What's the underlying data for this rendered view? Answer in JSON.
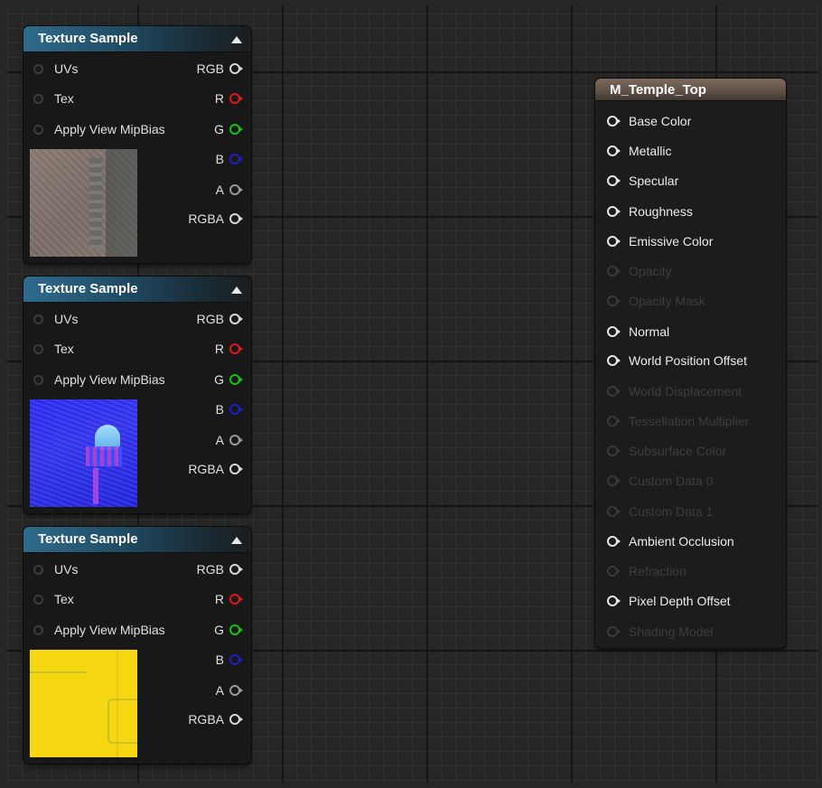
{
  "texture_nodes": [
    {
      "title": "Texture Sample",
      "inputs": [
        "UVs",
        "Tex",
        "Apply View MipBias"
      ],
      "outputs": [
        {
          "label": "RGB",
          "pin": "white-pin-icon"
        },
        {
          "label": "R",
          "pin": "red-pin-icon"
        },
        {
          "label": "G",
          "pin": "green-pin-icon"
        },
        {
          "label": "B",
          "pin": "blue-pin-icon"
        },
        {
          "label": "A",
          "pin": "gray-pin-icon"
        },
        {
          "label": "RGBA",
          "pin": "white-pin-icon"
        }
      ]
    },
    {
      "title": "Texture Sample",
      "inputs": [
        "UVs",
        "Tex",
        "Apply View MipBias"
      ],
      "outputs": [
        {
          "label": "RGB",
          "pin": "white-pin-icon"
        },
        {
          "label": "R",
          "pin": "red-pin-icon"
        },
        {
          "label": "G",
          "pin": "green-pin-icon"
        },
        {
          "label": "B",
          "pin": "blue-pin-icon"
        },
        {
          "label": "A",
          "pin": "gray-pin-icon"
        },
        {
          "label": "RGBA",
          "pin": "white-pin-icon"
        }
      ]
    },
    {
      "title": "Texture Sample",
      "inputs": [
        "UVs",
        "Tex",
        "Apply View MipBias"
      ],
      "outputs": [
        {
          "label": "RGB",
          "pin": "white-pin-icon"
        },
        {
          "label": "R",
          "pin": "red-pin-icon"
        },
        {
          "label": "G",
          "pin": "green-pin-icon"
        },
        {
          "label": "B",
          "pin": "blue-pin-icon"
        },
        {
          "label": "A",
          "pin": "gray-pin-icon"
        },
        {
          "label": "RGBA",
          "pin": "white-pin-icon"
        }
      ]
    }
  ],
  "material_node": {
    "title": "M_Temple_Top",
    "inputs": [
      {
        "label": "Base Color",
        "enabled": true
      },
      {
        "label": "Metallic",
        "enabled": true
      },
      {
        "label": "Specular",
        "enabled": true
      },
      {
        "label": "Roughness",
        "enabled": true
      },
      {
        "label": "Emissive Color",
        "enabled": true
      },
      {
        "label": "Opacity",
        "enabled": false
      },
      {
        "label": "Opacity Mask",
        "enabled": false
      },
      {
        "label": "Normal",
        "enabled": true
      },
      {
        "label": "World Position Offset",
        "enabled": true
      },
      {
        "label": "World Displacement",
        "enabled": false
      },
      {
        "label": "Tessellation Multiplier",
        "enabled": false
      },
      {
        "label": "Subsurface Color",
        "enabled": false
      },
      {
        "label": "Custom Data 0",
        "enabled": false
      },
      {
        "label": "Custom Data 1",
        "enabled": false
      },
      {
        "label": "Ambient Occlusion",
        "enabled": true
      },
      {
        "label": "Refraction",
        "enabled": false
      },
      {
        "label": "Pixel Depth Offset",
        "enabled": true
      },
      {
        "label": "Shading Model",
        "enabled": false
      }
    ]
  },
  "colors": {
    "graph_background": "#262626",
    "texture_header": "#2f6b8c",
    "material_header": "#7c6a5c",
    "pin_red": "#e0181b",
    "pin_green": "#18c118",
    "pin_blue": "#1e1ec8"
  }
}
